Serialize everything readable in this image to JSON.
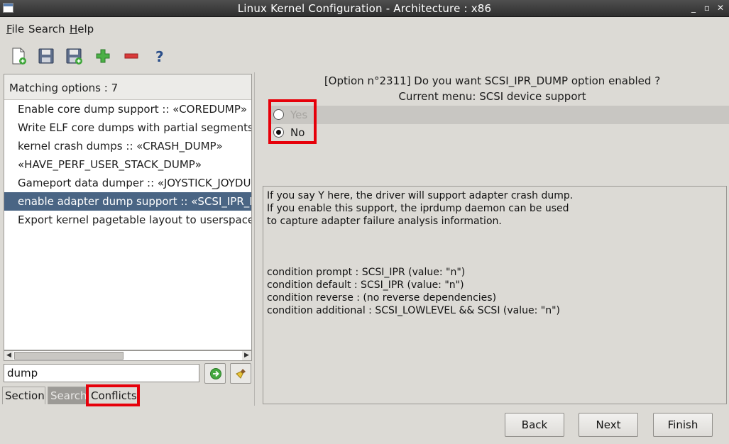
{
  "window": {
    "title": "Linux Kernel Configuration - Architecture : x86"
  },
  "menu": {
    "file": {
      "mnemonic": "F",
      "rest": "ile"
    },
    "search": "Search",
    "help": {
      "mnemonic": "H",
      "rest": "elp"
    }
  },
  "toolbar": {
    "icons": [
      "new-config-icon",
      "save-icon",
      "save-as-icon",
      "expand-all-icon",
      "collapse-all-icon",
      "help-icon"
    ]
  },
  "left": {
    "matching": "Matching options : 7",
    "options": [
      "Enable core dump support :: «COREDUMP»",
      "Write ELF core dumps with partial segments",
      "kernel crash dumps :: «CRASH_DUMP»",
      "«HAVE_PERF_USER_STACK_DUMP»",
      "Gameport data dumper :: «JOYSTICK_JOYDUMP»",
      "enable adapter dump support :: «SCSI_IPR_DUMP»",
      "Export kernel pagetable layout to userspace via debugfs"
    ],
    "selected_index": 5,
    "search_value": "dump",
    "tabs": {
      "section": "Section",
      "search": "Search",
      "conflicts": "Conflicts"
    },
    "active_tab": "Search"
  },
  "right": {
    "question": "[Option n°2311] Do you want SCSI_IPR_DUMP option enabled ?",
    "current_menu": "Current menu: SCSI device support",
    "radio_yes": "Yes",
    "radio_no": "No",
    "selected": "No",
    "help": {
      "line1": "If you say Y here, the driver will support adapter crash dump.",
      "line2": "If you enable this support, the iprdump daemon can be used",
      "line3": "to capture adapter failure analysis information.",
      "cond_prompt": "condition prompt : SCSI_IPR (value: \"n\")",
      "cond_default": "condition default :  SCSI_IPR (value: \"n\")",
      "cond_reverse": "condition reverse : (no reverse dependencies)",
      "cond_additional": "condition additional : SCSI_LOWLEVEL && SCSI (value: \"n\")"
    }
  },
  "buttons": {
    "back": "Back",
    "next": "Next",
    "finish": "Finish"
  },
  "colors": {
    "highlight": "#e6000a",
    "selection": "#4a6584"
  }
}
